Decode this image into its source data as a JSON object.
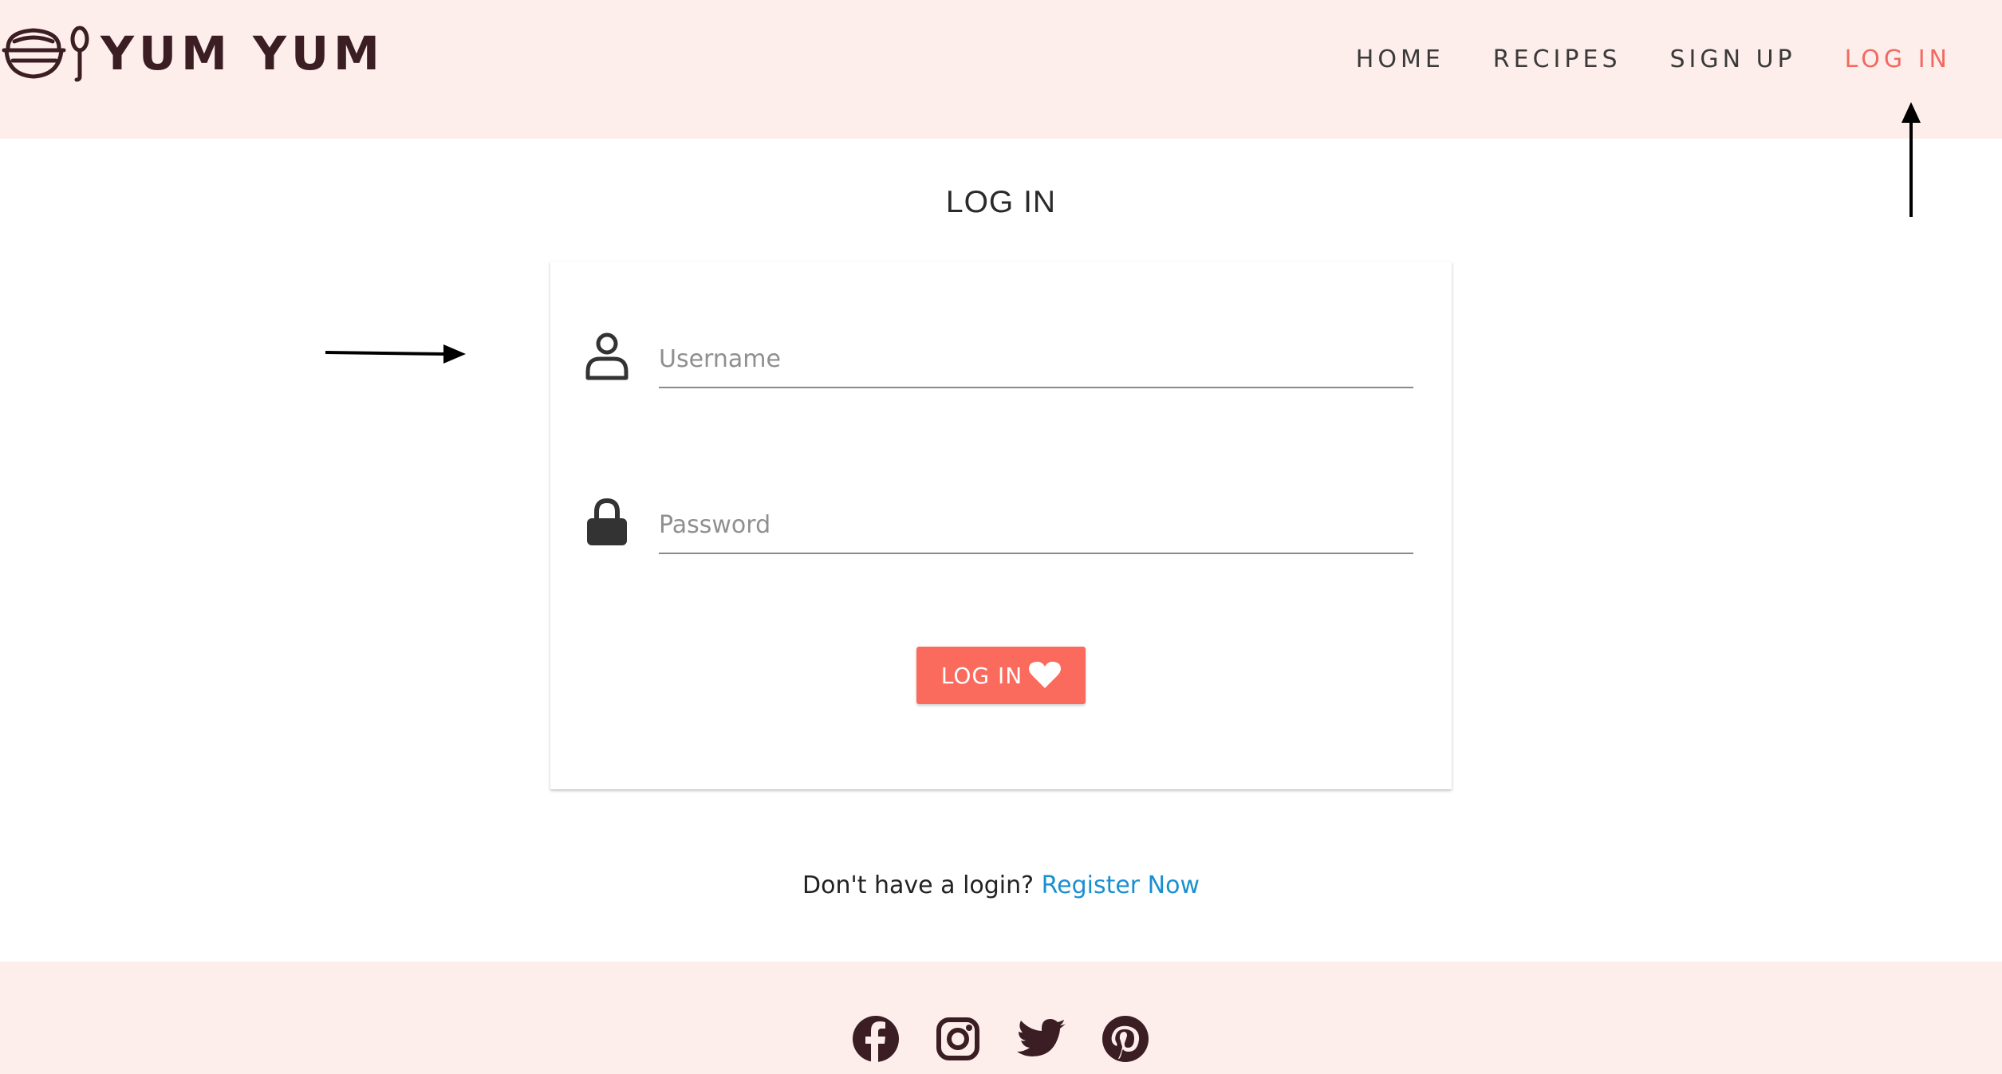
{
  "brand": {
    "name": "YUM YUM",
    "color": "#3a1e24"
  },
  "nav": {
    "items": [
      {
        "label": "HOME",
        "active": false
      },
      {
        "label": "RECIPES",
        "active": false
      },
      {
        "label": "SIGN UP",
        "active": false
      },
      {
        "label": "LOG IN",
        "active": true
      }
    ],
    "active_color": "#f16a61"
  },
  "page": {
    "title": "LOG IN"
  },
  "form": {
    "username": {
      "placeholder": "Username",
      "value": "",
      "icon": "user-icon"
    },
    "password": {
      "placeholder": "Password",
      "value": "",
      "icon": "lock-icon"
    },
    "submit": {
      "label": "LOG IN",
      "icon": "heart-icon",
      "color": "#fb6b5d"
    }
  },
  "register": {
    "prompt": "Don't have a login?",
    "link_label": "Register Now",
    "link_color": "#1a8fd0"
  },
  "footer": {
    "social": [
      "facebook-icon",
      "instagram-icon",
      "twitter-icon",
      "pinterest-icon"
    ]
  },
  "colors": {
    "header_bg": "#feeeeb",
    "footer_bg": "#feeeeb",
    "text": "#3a3a3a"
  }
}
